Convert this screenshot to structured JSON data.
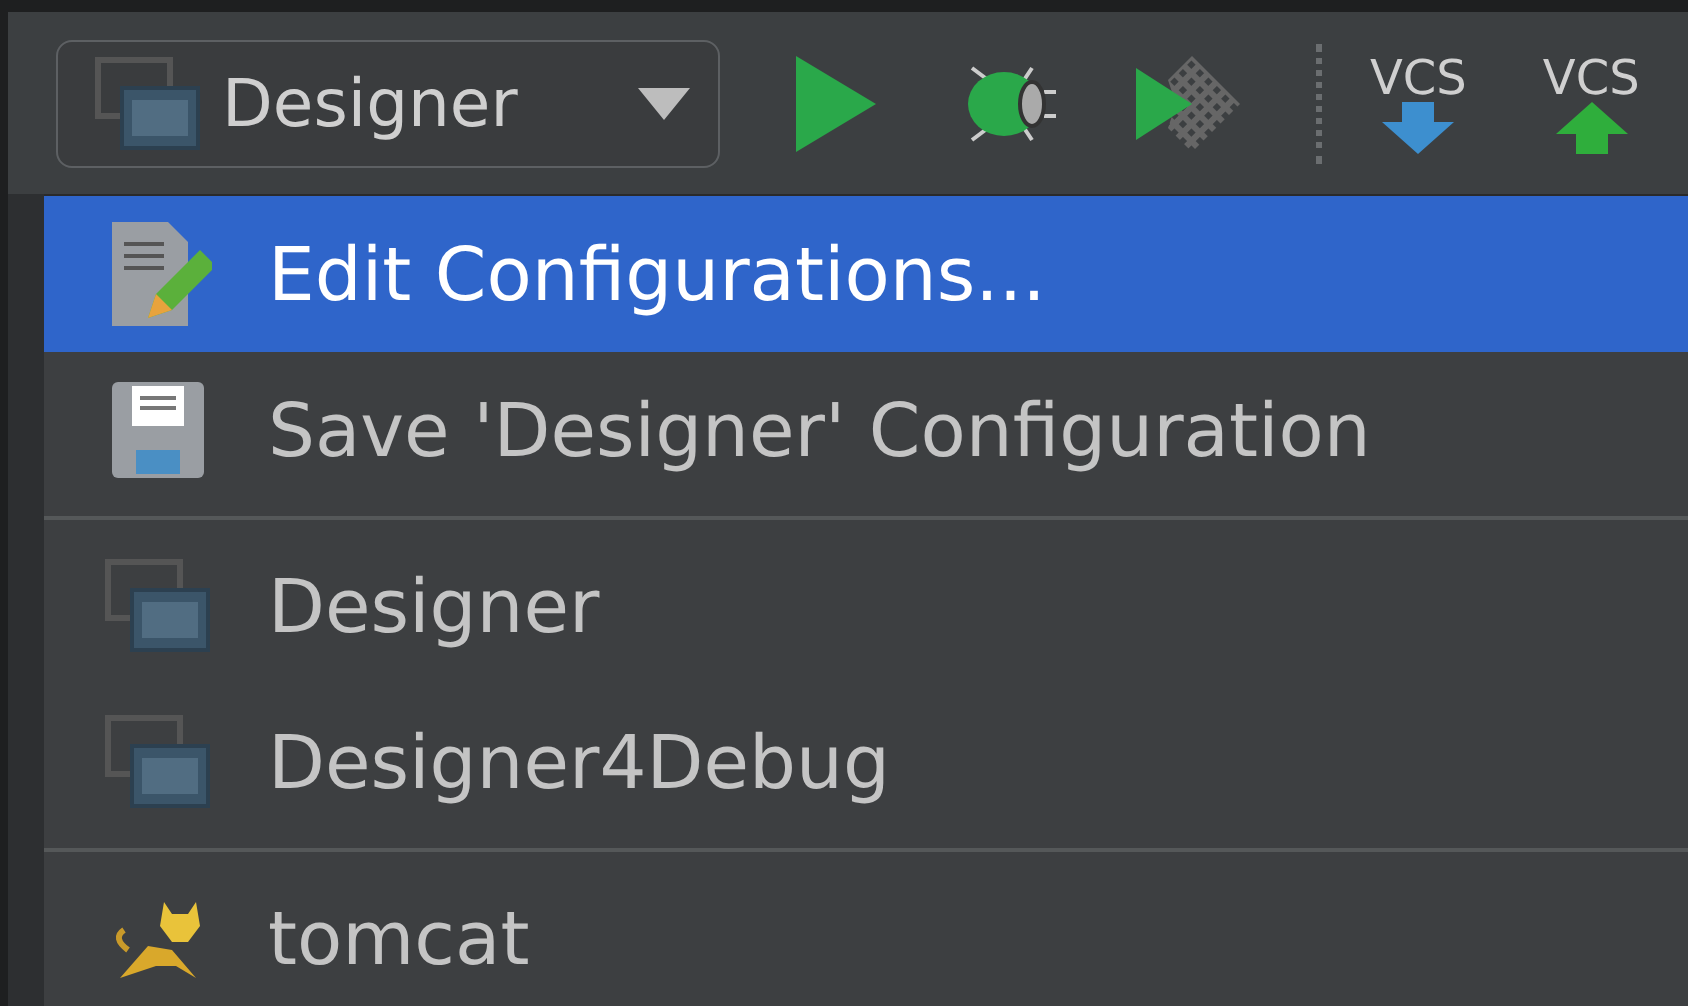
{
  "toolbar": {
    "config_selector": {
      "label": "Designer"
    },
    "buttons": [
      {
        "kind": "run"
      },
      {
        "kind": "debug"
      },
      {
        "kind": "coverage"
      },
      {
        "kind": "separator"
      },
      {
        "kind": "vcs_update",
        "label": "VCS"
      },
      {
        "kind": "vcs_commit",
        "label": "VCS"
      }
    ]
  },
  "menu": {
    "groups": [
      [
        {
          "label": "Edit Configurations...",
          "kind": "edit",
          "selected": true
        },
        {
          "label": "Save 'Designer' Configuration",
          "kind": "save",
          "selected": false
        }
      ],
      [
        {
          "label": "Designer",
          "kind": "app",
          "selected": false
        },
        {
          "label": "Designer4Debug",
          "kind": "app",
          "selected": false
        }
      ],
      [
        {
          "label": "tomcat",
          "kind": "tomcat",
          "selected": false
        }
      ]
    ]
  }
}
